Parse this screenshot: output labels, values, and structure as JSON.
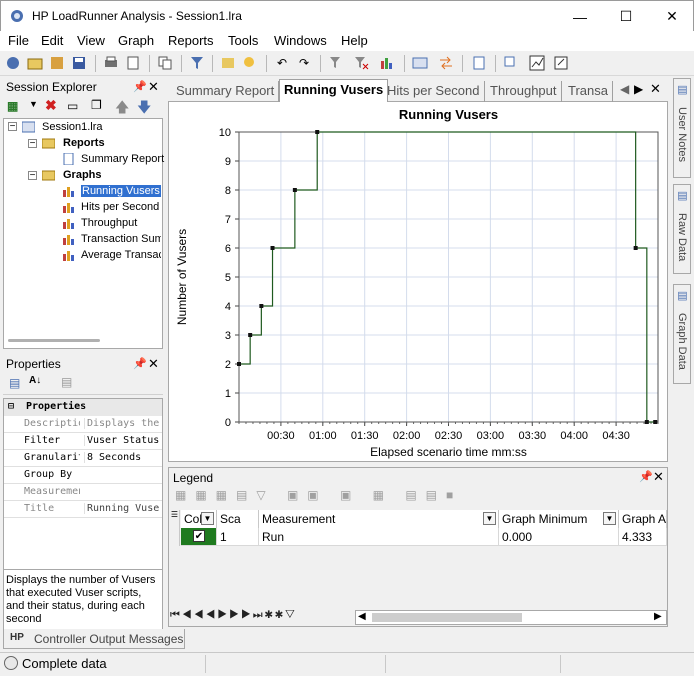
{
  "window": {
    "title": "HP LoadRunner Analysis - Session1.lra"
  },
  "menu": [
    "File",
    "Edit",
    "View",
    "Graph",
    "Reports",
    "Tools",
    "Windows",
    "Help"
  ],
  "session_explorer": {
    "title": "Session Explorer",
    "root": "Session1.lra",
    "reports_label": "Reports",
    "summary_report": "Summary Report",
    "graphs_label": "Graphs",
    "graphs": [
      "Running Vusers",
      "Hits per Second",
      "Throughput",
      "Transaction Summ",
      "Average Transac"
    ]
  },
  "properties": {
    "title": "Properties",
    "section": "Properties",
    "rows": [
      {
        "key": "Description",
        "value": "Displays the"
      },
      {
        "key": "Filter",
        "value": "Vuser Status"
      },
      {
        "key": "Granularity",
        "value": "8 Seconds"
      },
      {
        "key": "Group By",
        "value": ""
      },
      {
        "key": "Measurement",
        "value": ""
      },
      {
        "key": "Title",
        "value": "Running Vuser"
      }
    ],
    "description": "Displays the number of Vusers that executed Vuser scripts, and their status, during each second"
  },
  "tabs": [
    "Summary Report",
    "Running Vusers",
    "Hits per Second",
    "Throughput",
    "Transa"
  ],
  "chart_data": {
    "type": "line",
    "title": "Running Vusers",
    "xlabel": "Elapsed scenario time mm:ss",
    "ylabel": "Number of Vusers",
    "ylim": [
      0,
      10
    ],
    "yticks": [
      "0",
      "1",
      "2",
      "3",
      "4",
      "5",
      "6",
      "7",
      "8",
      "9",
      "10"
    ],
    "xticks": [
      "00:30",
      "01:00",
      "01:30",
      "02:00",
      "02:30",
      "03:00",
      "03:30",
      "04:00",
      "04:30"
    ],
    "xlim_seconds": [
      0,
      300
    ],
    "grid": true,
    "step": true,
    "series": [
      {
        "x_seconds": [
          0,
          8,
          16,
          24,
          40,
          56,
          284,
          292
        ],
        "values": [
          2,
          3,
          4,
          6,
          8,
          10,
          6,
          0
        ]
      }
    ],
    "color": "#1f5a1f"
  },
  "legend": {
    "title": "Legend",
    "columns": [
      "Col",
      "Sca",
      "Measurement",
      "Graph Minimum",
      "Graph Av"
    ],
    "rows": [
      {
        "scale": "1",
        "measurement": "Run",
        "min": "0.000",
        "avg": "4.333"
      }
    ]
  },
  "side_tabs": [
    "User Notes",
    "Raw Data",
    "Graph Data"
  ],
  "bottom_tab": "Controller Output Messages",
  "status": "Complete data"
}
